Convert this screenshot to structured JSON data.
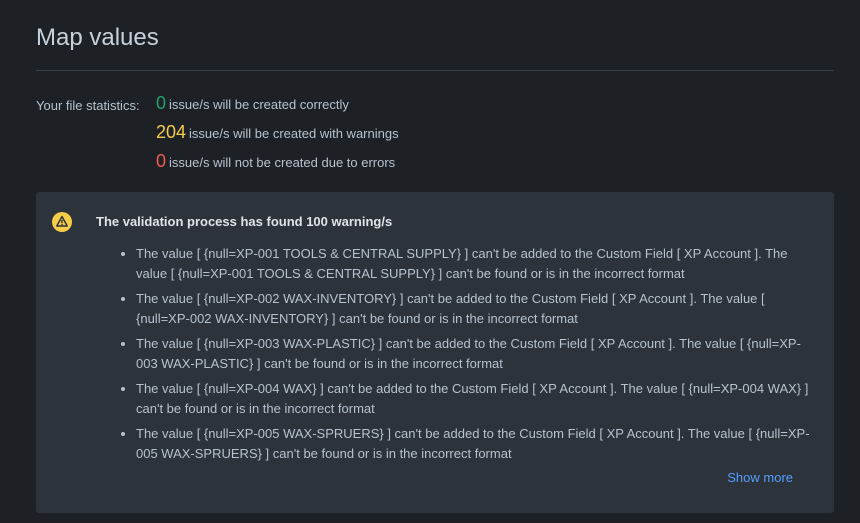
{
  "page": {
    "title": "Map values"
  },
  "stats": {
    "label": "Your file statistics:",
    "lines": [
      {
        "count": "0",
        "text": "issue/s will be created correctly",
        "color": "#22a06b"
      },
      {
        "count": "204",
        "text": "issue/s will be created with warnings",
        "color": "#f5cd47"
      },
      {
        "count": "0",
        "text": "issue/s will not be created due to errors",
        "color": "#f15b50"
      }
    ]
  },
  "warnings": {
    "icon": "warning-icon",
    "title": "The validation process has found 100 warning/s",
    "items": [
      "The value [ {null=XP-001 TOOLS & CENTRAL SUPPLY} ] can't be added to the Custom Field [ XP Account ]. The value [ {null=XP-001 TOOLS & CENTRAL SUPPLY} ] can't be found or is in the incorrect format",
      "The value [ {null=XP-002 WAX-INVENTORY} ] can't be added to the Custom Field [ XP Account ]. The value [ {null=XP-002 WAX-INVENTORY} ] can't be found or is in the incorrect format",
      "The value [ {null=XP-003 WAX-PLASTIC} ] can't be added to the Custom Field [ XP Account ]. The value [ {null=XP-003 WAX-PLASTIC} ] can't be found or is in the incorrect format",
      "The value [ {null=XP-004 WAX} ] can't be added to the Custom Field [ XP Account ]. The value [ {null=XP-004 WAX} ] can't be found or is in the incorrect format",
      "The value [ {null=XP-005 WAX-SPRUERS} ] can't be added to the Custom Field [ XP Account ]. The value [ {null=XP-005 WAX-SPRUERS} ] can't be found or is in the incorrect format"
    ],
    "show_more_label": "Show more"
  },
  "colors": {
    "background": "#1d2125",
    "panel": "#2c333a",
    "link": "#579dff",
    "warning_icon": "#f5cd47"
  }
}
